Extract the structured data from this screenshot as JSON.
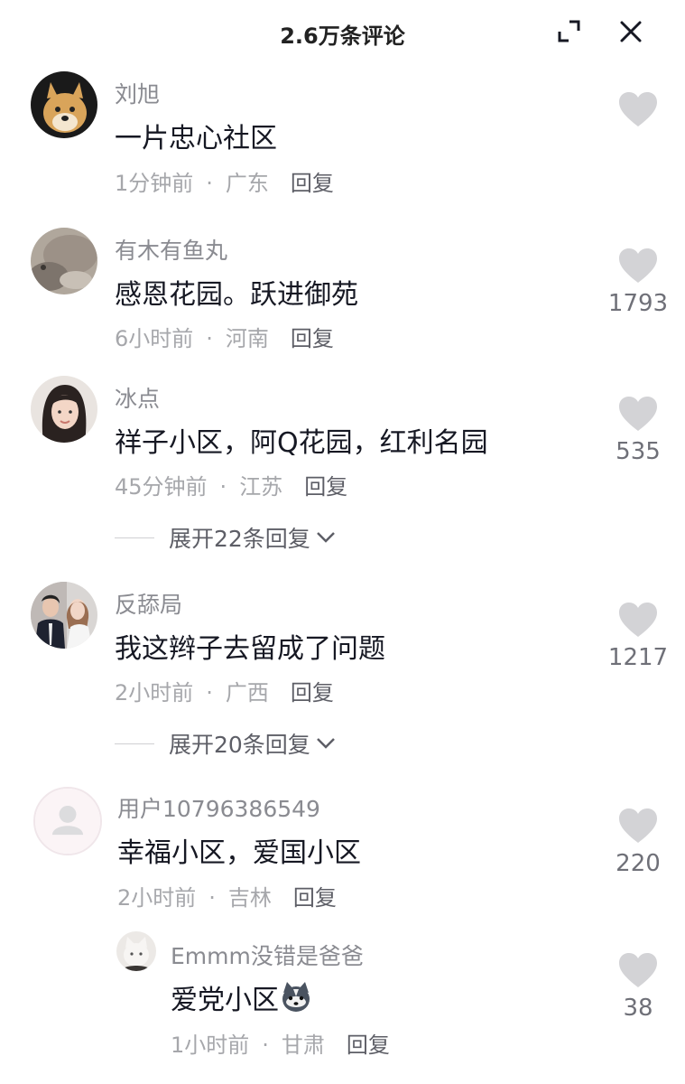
{
  "header": {
    "title": "2.6万条评论",
    "expand_icon": "expand-icon",
    "close_icon": "close-icon"
  },
  "comments": [
    {
      "username": "刘旭",
      "text": "一片忠心社区",
      "time": "1分钟前",
      "location": "广东",
      "reply_label": "回复",
      "likes": "",
      "avatar": "doge-avatar"
    },
    {
      "username": "有木有鱼丸",
      "text": "感恩花园。跃进御苑",
      "time": "6小时前",
      "location": "河南",
      "reply_label": "回复",
      "likes": "1793",
      "avatar": "stone-avatar"
    },
    {
      "username": "冰点",
      "text": "祥子小区，阿Q花园，红利名园",
      "time": "45分钟前",
      "location": "江苏",
      "reply_label": "回复",
      "likes": "535",
      "expand_replies": "展开22条回复",
      "avatar": "girl-avatar"
    },
    {
      "username": "反舔局",
      "text": "我这辫子去留成了问题",
      "time": "2小时前",
      "location": "广西",
      "reply_label": "回复",
      "likes": "1217",
      "expand_replies": "展开20条回复",
      "avatar": "couple-avatar"
    },
    {
      "username": "用户10796386549",
      "text": "幸福小区，爱国小区",
      "time": "2小时前",
      "location": "吉林",
      "reply_label": "回复",
      "likes": "220",
      "avatar": "default-user-avatar"
    },
    {
      "username": "Emmm没错是爸爸",
      "text": "爱党小区",
      "time": "1小时前",
      "location": "甘肃",
      "reply_label": "回复",
      "likes": "38",
      "avatar": "cat-avatar",
      "emoji": "husky-emoji"
    }
  ],
  "colors": {
    "text": "#161823",
    "username": "#8a8b91",
    "meta": "#a6a7ab",
    "heart": "#d3d3d6"
  },
  "separator": "·"
}
